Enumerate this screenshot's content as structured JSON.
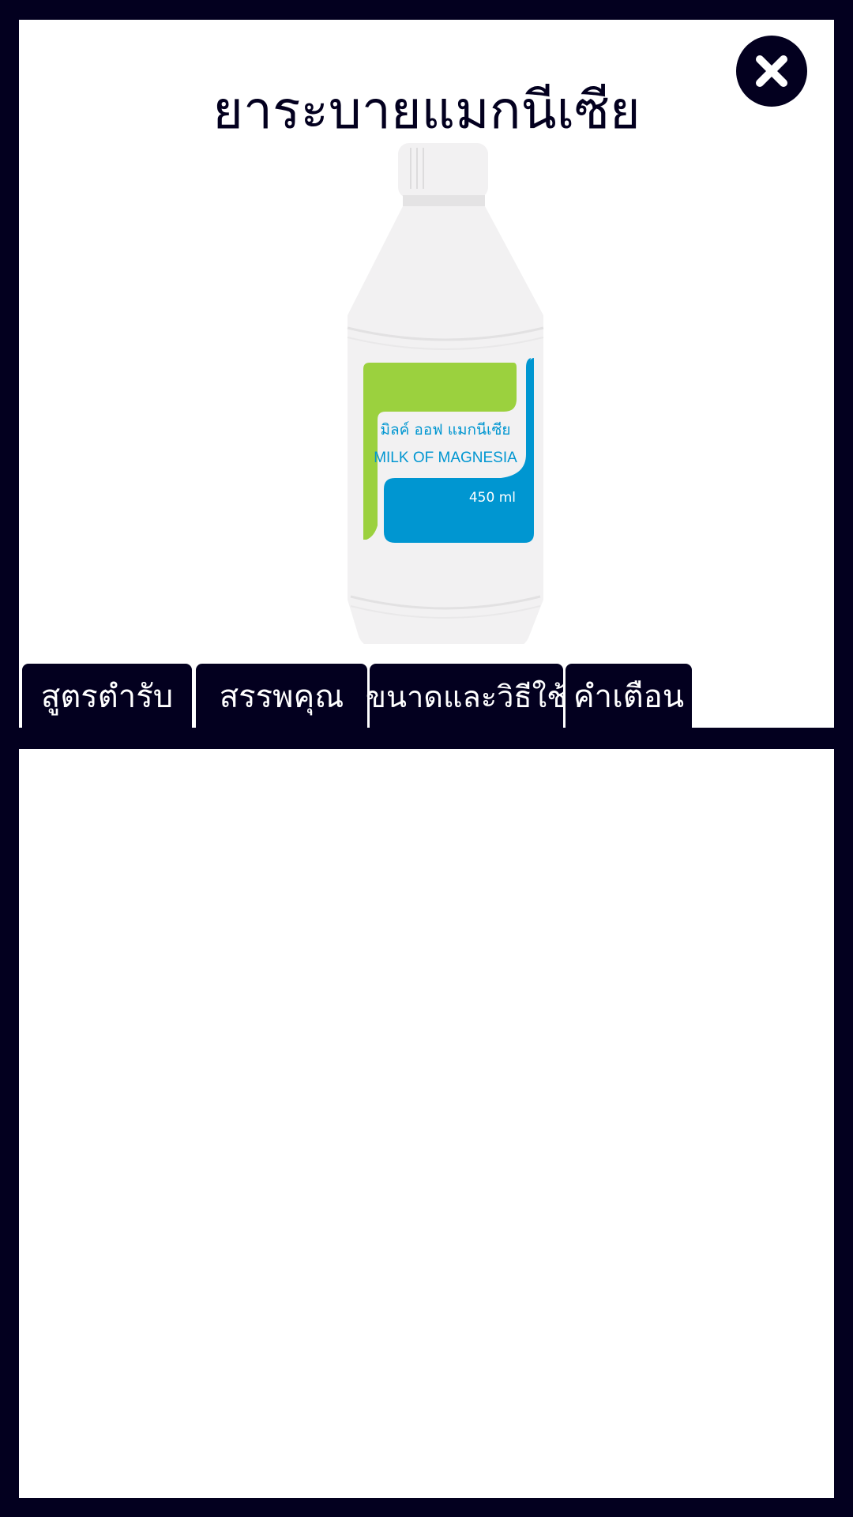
{
  "title": "ยาระบายแมกนีเซีย",
  "close": {
    "icon": "close-icon"
  },
  "product": {
    "label_thai": "มิลค์ ออฟ แมกนีเซีย",
    "label_english": "MILK OF MAGNESIA",
    "volume": "450 ml",
    "colors": {
      "green": "#9bd13e",
      "blue": "#0096d1",
      "bottle": "#f2f1f2"
    }
  },
  "tabs": [
    {
      "label": "สูตรตำรับ"
    },
    {
      "label": "สรรพคุณ"
    },
    {
      "label": "ขนาดและวิธีใช้"
    },
    {
      "label": "คำเตือน"
    }
  ],
  "theme": {
    "dark": "#03001f",
    "panel": "#ffffff"
  }
}
